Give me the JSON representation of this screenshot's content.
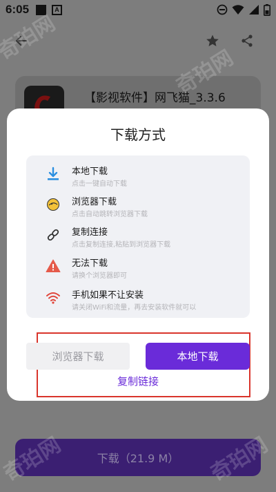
{
  "status_bar": {
    "time": "6:05",
    "a_badge": "A"
  },
  "app": {
    "title": "【影视软件】网飞猫_3.3.6"
  },
  "download_bar": {
    "label": "下载（21.9 M）"
  },
  "watermark": {
    "text": "奇珀网"
  },
  "dialog": {
    "title": "下载方式",
    "options": [
      {
        "title": "本地下载",
        "desc": "点击一键自动下载",
        "icon": "download-icon",
        "color": "#2b8fe0"
      },
      {
        "title": "浏览器下载",
        "desc": "点击自动跳转浏览器下载",
        "icon": "browser-icon",
        "color": "#f3c23a"
      },
      {
        "title": "复制连接",
        "desc": "点击复制连接,粘贴到浏览器下载",
        "icon": "link-icon",
        "color": "#333333"
      },
      {
        "title": "无法下载",
        "desc": "请换个浏览器即可",
        "icon": "warning-icon",
        "color": "#e55a4a"
      },
      {
        "title": "手机如果不让安装",
        "desc": "请关闭WiFi和流量，再去安装软件就可以",
        "icon": "wifi-icon",
        "color": "#e0453a"
      }
    ],
    "browser_button": "浏览器下载",
    "local_button": "本地下载",
    "copy_link": "复制链接"
  },
  "colors": {
    "accent": "#6a2bd9",
    "highlight_box": "#d9342b"
  }
}
